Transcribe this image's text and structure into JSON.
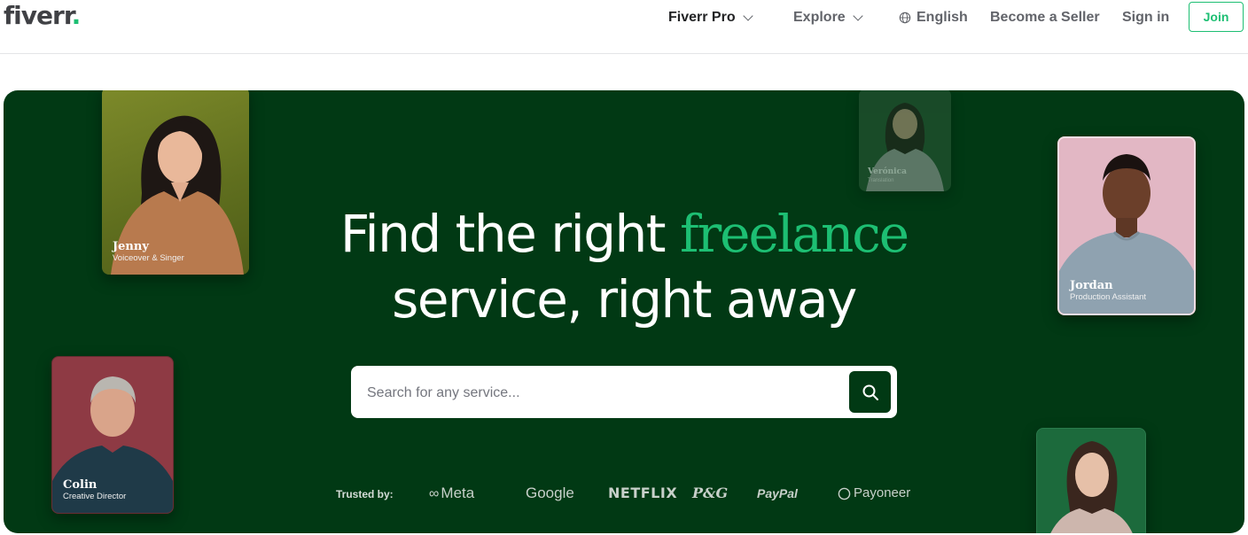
{
  "brand": {
    "name": "fiverr",
    "dot": "."
  },
  "nav": {
    "fiverr_pro": "Fiverr Pro",
    "explore": "Explore",
    "language": "English",
    "become_seller": "Become a Seller",
    "sign_in": "Sign in",
    "join": "Join"
  },
  "hero": {
    "headline_part1": "Find the right ",
    "headline_accent": "freelance",
    "headline_line2": "service, right away",
    "search_placeholder": "Search for any service...",
    "trusted_label": "Trusted by:",
    "brands": [
      "Meta",
      "Google",
      "NETFLIX",
      "P&G",
      "PayPal",
      "Payoneer"
    ]
  },
  "cards": [
    {
      "name": "Jenny",
      "role": "Voiceover & Singer"
    },
    {
      "name": "Verónica",
      "role": "Translation"
    },
    {
      "name": "Jordan",
      "role": "Production Assistant"
    },
    {
      "name": "Colin",
      "role": "Creative Director"
    },
    {
      "name": "",
      "role": ""
    }
  ],
  "colors": {
    "accent": "#1dbf73",
    "hero_bg": "#013914",
    "text": "#404145"
  }
}
